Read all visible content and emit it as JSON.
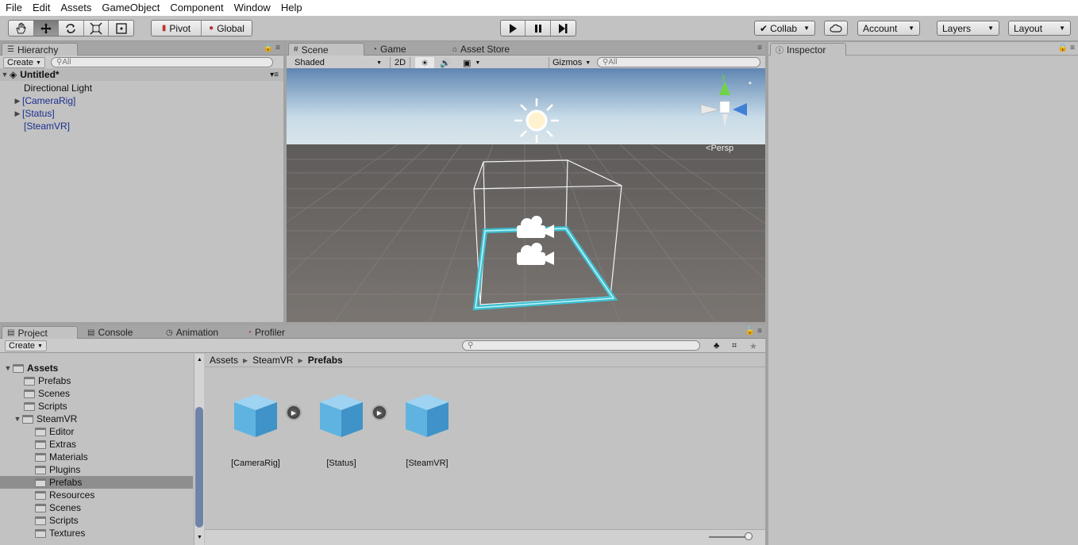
{
  "menu": [
    "File",
    "Edit",
    "Assets",
    "GameObject",
    "Component",
    "Window",
    "Help"
  ],
  "toolbar": {
    "pivot": "Pivot",
    "global": "Global",
    "collab": "Collab",
    "account": "Account",
    "layers": "Layers",
    "layout": "Layout"
  },
  "hierarchy": {
    "tab": "Hierarchy",
    "create": "Create",
    "search_placeholder": "All",
    "scene": "Untitled*",
    "items": [
      "Directional Light",
      "[CameraRig]",
      "[Status]",
      "[SteamVR]"
    ]
  },
  "scene": {
    "tabs": [
      "Scene",
      "Game",
      "Asset Store"
    ],
    "shading": "Shaded",
    "mode2d": "2D",
    "gizmos": "Gizmos",
    "search_placeholder": "All",
    "persp": "Persp",
    "axis_y": "y"
  },
  "inspector": {
    "tab": "Inspector"
  },
  "bottom": {
    "tabs": [
      "Project",
      "Console",
      "Animation",
      "Profiler"
    ],
    "create": "Create"
  },
  "project_tree": {
    "root": "Assets",
    "root_children": [
      "Prefabs",
      "Scenes",
      "Scripts"
    ],
    "steamvr": "SteamVR",
    "steamvr_children": [
      "Editor",
      "Extras",
      "Materials",
      "Plugins",
      "Prefabs",
      "Resources",
      "Scenes",
      "Scripts",
      "Textures"
    ],
    "selected": "Prefabs"
  },
  "breadcrumb": [
    "Assets",
    "SteamVR",
    "Prefabs"
  ],
  "assets": [
    "[CameraRig]",
    "[Status]",
    "[SteamVR]"
  ],
  "colors": {
    "accent_blue": "#1b2f8e",
    "selection": "#8e8e8e",
    "cube": "#5fb3e0",
    "outline": "#39c5d8"
  }
}
